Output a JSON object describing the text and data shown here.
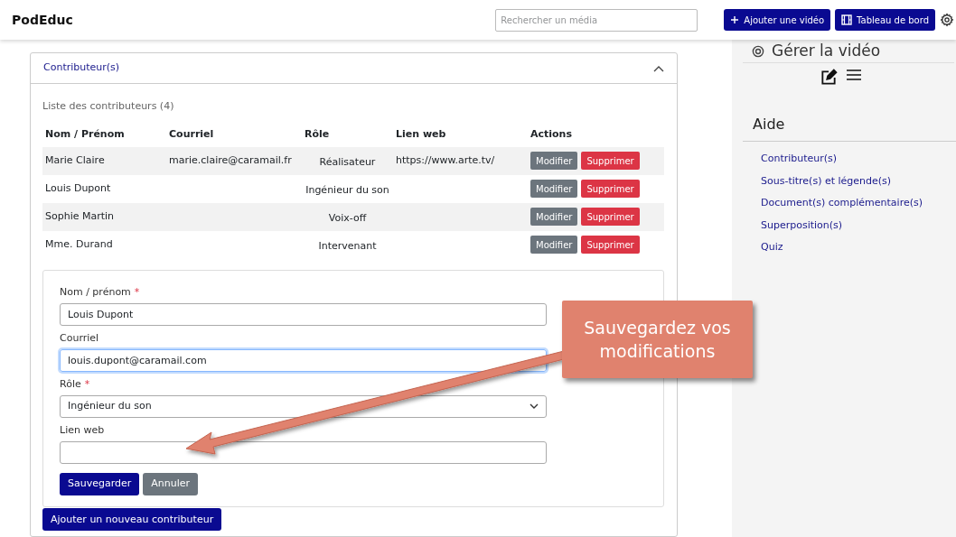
{
  "header": {
    "logo": "PodEduc",
    "search": {
      "placeholder": "Rechercher un média"
    },
    "buttons": [
      "Ajouter une vidéo",
      "Tableau de bord"
    ]
  },
  "section": {
    "title": "Contributeur(s)",
    "expanded": true,
    "list_title": "Liste des contributeurs (4)",
    "columns": [
      "Nom / Prénom",
      "Courriel",
      "Rôle",
      "Lien web",
      "Actions"
    ],
    "rows": [
      {
        "name": "Marie Claire",
        "email": "marie.claire@caramail.fr",
        "role": "Réalisateur",
        "link": "https://www.arte.tv/",
        "actions": [
          "Modifier",
          "Supprimer"
        ]
      },
      {
        "name": "Louis Dupont",
        "role": "Ingénieur du son",
        "actions": [
          "Modifier",
          "Supprimer"
        ]
      },
      {
        "name": "Sophie Martin",
        "role": "Voix-off",
        "actions": [
          "Modifier",
          "Supprimer"
        ]
      },
      {
        "name": "Mme. Durand",
        "role": "Intervenant",
        "actions": [
          "Modifier",
          "Supprimer"
        ]
      }
    ],
    "form": {
      "required_mark": "*",
      "fields": [
        {
          "kind": "text",
          "label": "Nom / prénom",
          "required": true,
          "value": "Louis Dupont",
          "focused": false
        },
        {
          "kind": "text",
          "label": "Courriel",
          "required": false,
          "value": "louis.dupont@caramail.com",
          "focused": true
        },
        {
          "kind": "select",
          "label": "Rôle",
          "required": true,
          "value": "Ingénieur du son",
          "focused": false
        },
        {
          "kind": "text",
          "label": "Lien web",
          "required": false,
          "focused": false
        }
      ],
      "buttons": [
        {
          "label": "Sauvegarder",
          "kind": "primary"
        },
        {
          "label": "Annuler",
          "kind": "secondary"
        }
      ]
    },
    "add_button": "Ajouter un nouveau contributeur"
  },
  "sidebar": {
    "manage_title": "Gérer la vidéo",
    "help_title": "Aide",
    "help_links": [
      "Contributeur(s)",
      "Sous-titre(s) et légende(s)",
      "Document(s) complémentaire(s)",
      "Superposition(s)",
      "Quiz"
    ]
  },
  "callout": "Sauvegardez vos modifications"
}
